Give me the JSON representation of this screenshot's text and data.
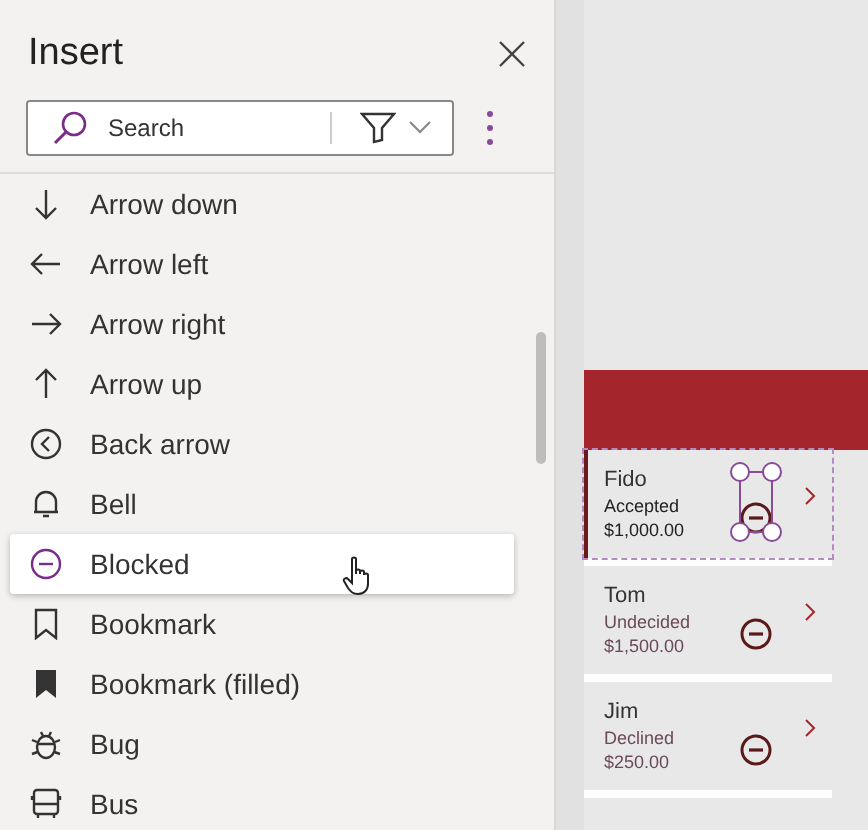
{
  "panel": {
    "title": "Insert",
    "search": {
      "placeholder": "Search"
    }
  },
  "items": [
    {
      "label": "Arrow down",
      "kind": "arrowdown",
      "hovered": false
    },
    {
      "label": "Arrow left",
      "kind": "arrowleft",
      "hovered": false
    },
    {
      "label": "Arrow right",
      "kind": "arrowright",
      "hovered": false
    },
    {
      "label": "Arrow up",
      "kind": "arrowup",
      "hovered": false
    },
    {
      "label": "Back arrow",
      "kind": "backarrow",
      "hovered": false
    },
    {
      "label": "Bell",
      "kind": "bell",
      "hovered": false
    },
    {
      "label": "Blocked",
      "kind": "blocked",
      "hovered": true
    },
    {
      "label": "Bookmark",
      "kind": "bookmark",
      "hovered": false
    },
    {
      "label": "Bookmark (filled)",
      "kind": "bookmarkfilled",
      "hovered": false
    },
    {
      "label": "Bug",
      "kind": "bug",
      "hovered": false
    },
    {
      "label": "Bus",
      "kind": "bus",
      "hovered": false
    }
  ],
  "gallery": [
    {
      "name": "Fido",
      "status": "Accepted",
      "amount": "$1,000.00",
      "selected": true
    },
    {
      "name": "Tom",
      "status": "Undecided",
      "amount": "$1,500.00",
      "selected": false
    },
    {
      "name": "Jim",
      "status": "Declined",
      "amount": "$250.00",
      "selected": false
    }
  ]
}
